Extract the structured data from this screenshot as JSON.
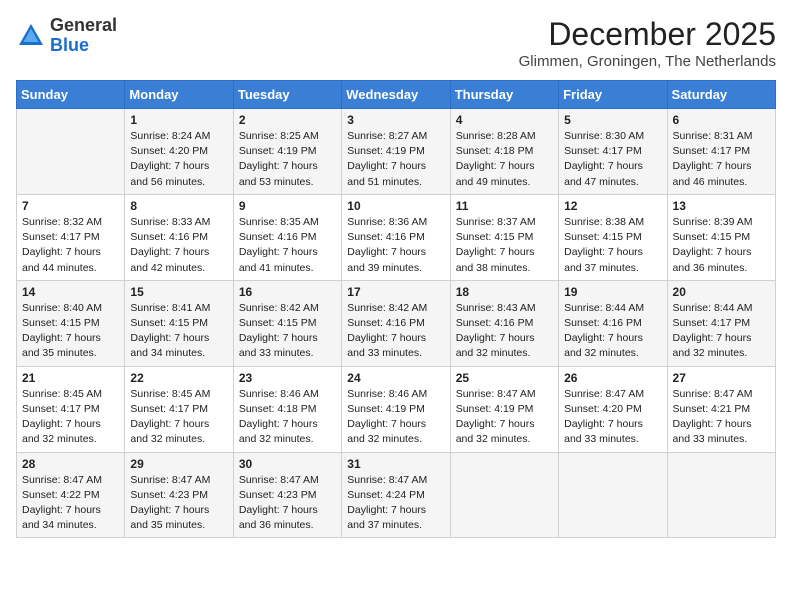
{
  "header": {
    "logo_line1": "General",
    "logo_line2": "Blue",
    "month": "December 2025",
    "location": "Glimmen, Groningen, The Netherlands"
  },
  "days_of_week": [
    "Sunday",
    "Monday",
    "Tuesday",
    "Wednesday",
    "Thursday",
    "Friday",
    "Saturday"
  ],
  "weeks": [
    [
      {
        "day": "",
        "info": ""
      },
      {
        "day": "1",
        "info": "Sunrise: 8:24 AM\nSunset: 4:20 PM\nDaylight: 7 hours\nand 56 minutes."
      },
      {
        "day": "2",
        "info": "Sunrise: 8:25 AM\nSunset: 4:19 PM\nDaylight: 7 hours\nand 53 minutes."
      },
      {
        "day": "3",
        "info": "Sunrise: 8:27 AM\nSunset: 4:19 PM\nDaylight: 7 hours\nand 51 minutes."
      },
      {
        "day": "4",
        "info": "Sunrise: 8:28 AM\nSunset: 4:18 PM\nDaylight: 7 hours\nand 49 minutes."
      },
      {
        "day": "5",
        "info": "Sunrise: 8:30 AM\nSunset: 4:17 PM\nDaylight: 7 hours\nand 47 minutes."
      },
      {
        "day": "6",
        "info": "Sunrise: 8:31 AM\nSunset: 4:17 PM\nDaylight: 7 hours\nand 46 minutes."
      }
    ],
    [
      {
        "day": "7",
        "info": "Sunrise: 8:32 AM\nSunset: 4:17 PM\nDaylight: 7 hours\nand 44 minutes."
      },
      {
        "day": "8",
        "info": "Sunrise: 8:33 AM\nSunset: 4:16 PM\nDaylight: 7 hours\nand 42 minutes."
      },
      {
        "day": "9",
        "info": "Sunrise: 8:35 AM\nSunset: 4:16 PM\nDaylight: 7 hours\nand 41 minutes."
      },
      {
        "day": "10",
        "info": "Sunrise: 8:36 AM\nSunset: 4:16 PM\nDaylight: 7 hours\nand 39 minutes."
      },
      {
        "day": "11",
        "info": "Sunrise: 8:37 AM\nSunset: 4:15 PM\nDaylight: 7 hours\nand 38 minutes."
      },
      {
        "day": "12",
        "info": "Sunrise: 8:38 AM\nSunset: 4:15 PM\nDaylight: 7 hours\nand 37 minutes."
      },
      {
        "day": "13",
        "info": "Sunrise: 8:39 AM\nSunset: 4:15 PM\nDaylight: 7 hours\nand 36 minutes."
      }
    ],
    [
      {
        "day": "14",
        "info": "Sunrise: 8:40 AM\nSunset: 4:15 PM\nDaylight: 7 hours\nand 35 minutes."
      },
      {
        "day": "15",
        "info": "Sunrise: 8:41 AM\nSunset: 4:15 PM\nDaylight: 7 hours\nand 34 minutes."
      },
      {
        "day": "16",
        "info": "Sunrise: 8:42 AM\nSunset: 4:15 PM\nDaylight: 7 hours\nand 33 minutes."
      },
      {
        "day": "17",
        "info": "Sunrise: 8:42 AM\nSunset: 4:16 PM\nDaylight: 7 hours\nand 33 minutes."
      },
      {
        "day": "18",
        "info": "Sunrise: 8:43 AM\nSunset: 4:16 PM\nDaylight: 7 hours\nand 32 minutes."
      },
      {
        "day": "19",
        "info": "Sunrise: 8:44 AM\nSunset: 4:16 PM\nDaylight: 7 hours\nand 32 minutes."
      },
      {
        "day": "20",
        "info": "Sunrise: 8:44 AM\nSunset: 4:17 PM\nDaylight: 7 hours\nand 32 minutes."
      }
    ],
    [
      {
        "day": "21",
        "info": "Sunrise: 8:45 AM\nSunset: 4:17 PM\nDaylight: 7 hours\nand 32 minutes."
      },
      {
        "day": "22",
        "info": "Sunrise: 8:45 AM\nSunset: 4:17 PM\nDaylight: 7 hours\nand 32 minutes."
      },
      {
        "day": "23",
        "info": "Sunrise: 8:46 AM\nSunset: 4:18 PM\nDaylight: 7 hours\nand 32 minutes."
      },
      {
        "day": "24",
        "info": "Sunrise: 8:46 AM\nSunset: 4:19 PM\nDaylight: 7 hours\nand 32 minutes."
      },
      {
        "day": "25",
        "info": "Sunrise: 8:47 AM\nSunset: 4:19 PM\nDaylight: 7 hours\nand 32 minutes."
      },
      {
        "day": "26",
        "info": "Sunrise: 8:47 AM\nSunset: 4:20 PM\nDaylight: 7 hours\nand 33 minutes."
      },
      {
        "day": "27",
        "info": "Sunrise: 8:47 AM\nSunset: 4:21 PM\nDaylight: 7 hours\nand 33 minutes."
      }
    ],
    [
      {
        "day": "28",
        "info": "Sunrise: 8:47 AM\nSunset: 4:22 PM\nDaylight: 7 hours\nand 34 minutes."
      },
      {
        "day": "29",
        "info": "Sunrise: 8:47 AM\nSunset: 4:23 PM\nDaylight: 7 hours\nand 35 minutes."
      },
      {
        "day": "30",
        "info": "Sunrise: 8:47 AM\nSunset: 4:23 PM\nDaylight: 7 hours\nand 36 minutes."
      },
      {
        "day": "31",
        "info": "Sunrise: 8:47 AM\nSunset: 4:24 PM\nDaylight: 7 hours\nand 37 minutes."
      },
      {
        "day": "",
        "info": ""
      },
      {
        "day": "",
        "info": ""
      },
      {
        "day": "",
        "info": ""
      }
    ]
  ]
}
